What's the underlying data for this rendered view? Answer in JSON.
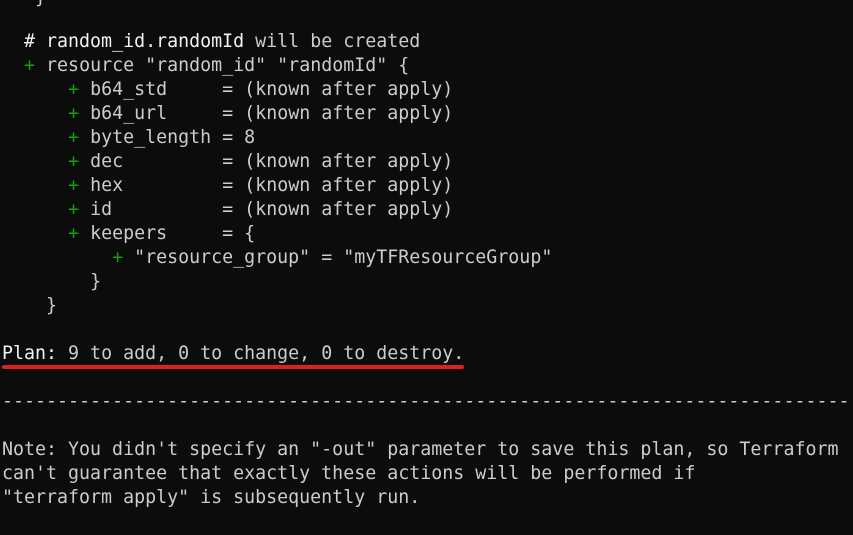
{
  "terminal": {
    "top_partial": "}",
    "comment": "# random_id.randomId will be created",
    "resource_line": "resource \"random_id\" \"randomId\" {",
    "plus_sign": "+",
    "attributes": [
      {
        "key": "b64_std",
        "pad": "    ",
        "value": "= (known after apply)"
      },
      {
        "key": "b64_url",
        "pad": "    ",
        "value": "= (known after apply)"
      },
      {
        "key": "byte_length",
        "pad": "",
        "value": "= 8"
      },
      {
        "key": "dec",
        "pad": "        ",
        "value": "= (known after apply)"
      },
      {
        "key": "hex",
        "pad": "        ",
        "value": "= (known after apply)"
      },
      {
        "key": "id",
        "pad": "         ",
        "value": "= (known after apply)"
      },
      {
        "key": "keepers",
        "pad": "    ",
        "value": "= {"
      }
    ],
    "keeper_entry": "\"resource_group\" = \"myTFResourceGroup\"",
    "keepers_close": "}",
    "resource_close": "}",
    "plan_label": "Plan:",
    "plan_summary": "9 to add, 0 to change, 0 to destroy.",
    "separator": "-----------------------------------------------------------------------------",
    "note_lines": [
      "Note: You didn't specify an \"-out\" parameter to save this plan, so Terraform",
      "can't guarantee that exactly these actions will be performed if",
      "\"terraform apply\" is subsequently run."
    ]
  },
  "colors": {
    "background": "#0c0c0c",
    "text": "#cccccc",
    "bold_text": "#f2f2f2",
    "plus": "#13a10e",
    "annotation_underline": "#e02020"
  }
}
